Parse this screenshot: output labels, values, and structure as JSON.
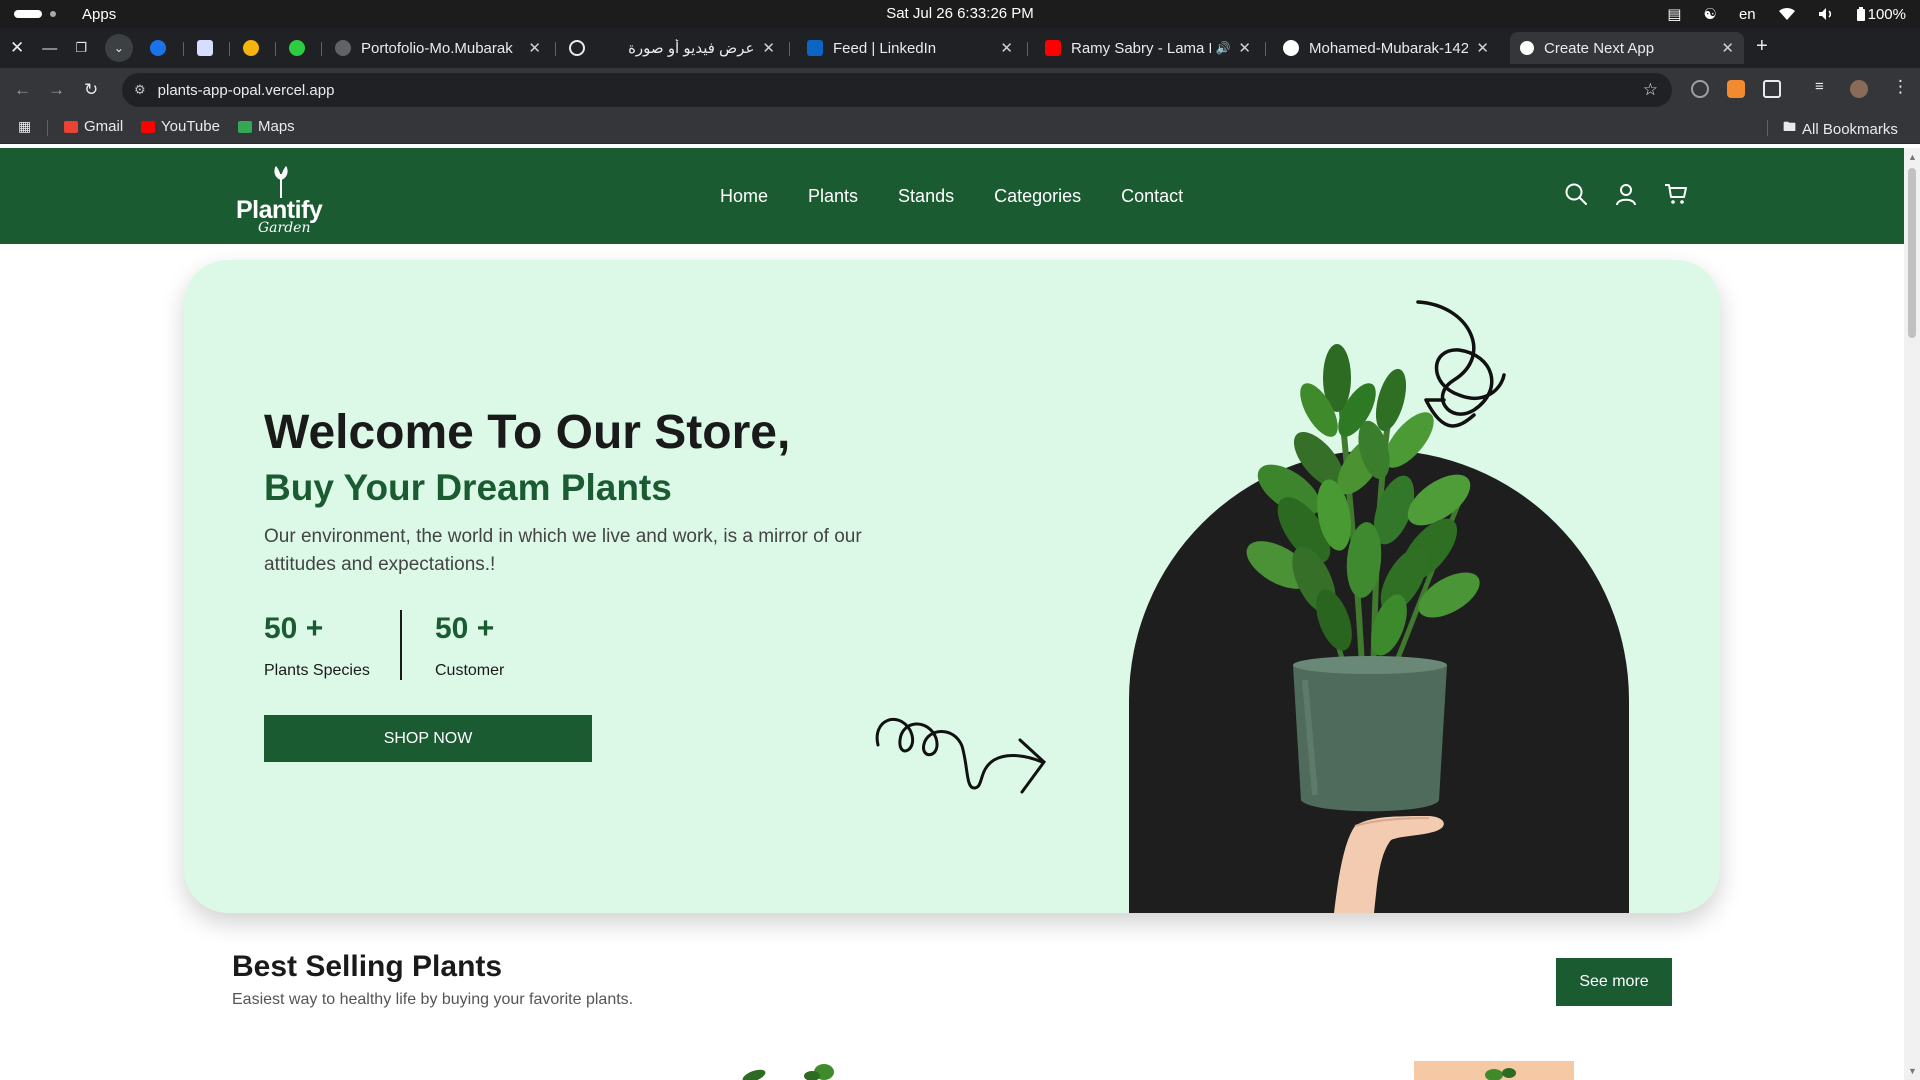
{
  "os": {
    "apps_label": "Apps",
    "clock": "Sat Jul 26    6:33:26 PM",
    "lang": "en",
    "battery": "100%"
  },
  "tabs": [
    {
      "title": "Portofolio-Mo.Mubarak",
      "favicon_color": "#5f6368"
    },
    {
      "title": "عرض فيديو أو صورة",
      "favicon_color": "#e8eaed"
    },
    {
      "title": "Feed | LinkedIn",
      "favicon_color": "#0a66c2"
    },
    {
      "title": "Ramy Sabry - Lama By",
      "favicon_color": "#ff0000"
    },
    {
      "title": "Mohamed-Mubarak-142",
      "favicon_color": "#ffffff"
    },
    {
      "title": "Create Next App",
      "favicon_color": "#ffffff"
    }
  ],
  "address_bar": {
    "url": "plants-app-opal.vercel.app"
  },
  "bookmarks": [
    {
      "label": "Gmail",
      "color": "#ea4335"
    },
    {
      "label": "YouTube",
      "color": "#ff0000"
    },
    {
      "label": "Maps",
      "color": "#34a853"
    }
  ],
  "all_bookmarks_label": "All Bookmarks",
  "site": {
    "logo_word": "Plantify",
    "logo_script": "Garden",
    "nav": [
      "Home",
      "Plants",
      "Stands",
      "Categories",
      "Contact"
    ],
    "brand_color": "#1a5b32"
  },
  "hero": {
    "title": "Welcome To Our Store,",
    "subtitle": "Buy Your Dream Plants",
    "description": "Our environment, the world in which we live and work, is a mirror of our attitudes and expectations.!",
    "stats": [
      {
        "value": "50 +",
        "label": "Plants Species"
      },
      {
        "value": "50 +",
        "label": "Customer"
      }
    ],
    "cta": "SHOP NOW",
    "background": "#dcf9e8"
  },
  "best_selling": {
    "title": "Best Selling Plants",
    "subtitle": "Easiest way to healthy life by buying your favorite plants.",
    "see_more": "See more"
  }
}
